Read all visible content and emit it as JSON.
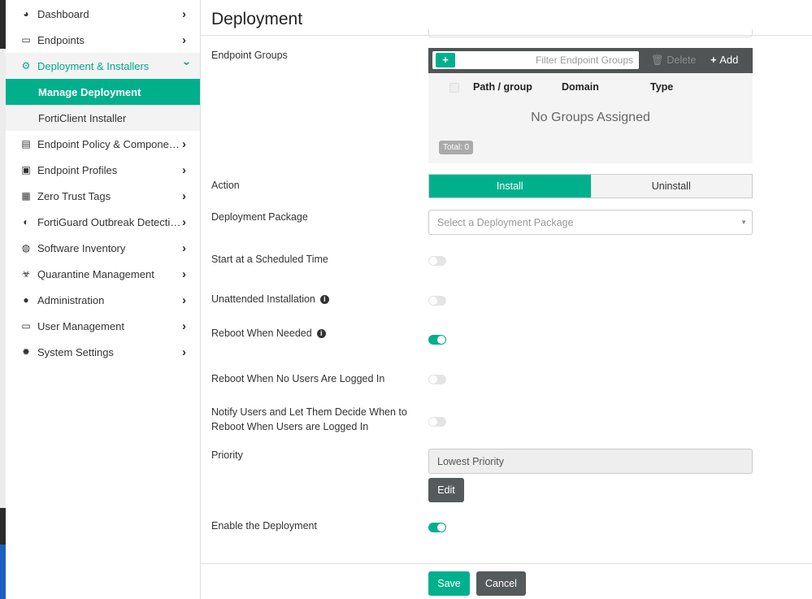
{
  "sidebar": {
    "items": [
      {
        "label": "Dashboard",
        "icon": "dashboard-icon"
      },
      {
        "label": "Endpoints",
        "icon": "endpoints-icon"
      },
      {
        "label": "Deployment & Installers",
        "icon": "deployment-icon",
        "expanded": true,
        "children": [
          {
            "label": "Manage Deployment",
            "active": true
          },
          {
            "label": "FortiClient Installer"
          }
        ]
      },
      {
        "label": "Endpoint Policy & Components",
        "icon": "policy-icon"
      },
      {
        "label": "Endpoint Profiles",
        "icon": "profiles-icon"
      },
      {
        "label": "Zero Trust Tags",
        "icon": "tags-icon"
      },
      {
        "label": "FortiGuard Outbreak Detecti…",
        "icon": "outbreak-icon"
      },
      {
        "label": "Software Inventory",
        "icon": "inventory-icon"
      },
      {
        "label": "Quarantine Management",
        "icon": "biohazard-icon"
      },
      {
        "label": "Administration",
        "icon": "users-icon"
      },
      {
        "label": "User Management",
        "icon": "id-card-icon"
      },
      {
        "label": "System Settings",
        "icon": "gear-icon"
      }
    ]
  },
  "page": {
    "title": "Deployment"
  },
  "form": {
    "endpoint_groups": {
      "label": "Endpoint Groups",
      "filter_placeholder": "Filter Endpoint Groups",
      "delete": "Delete",
      "add": "Add",
      "columns": [
        "Path / group",
        "Domain",
        "Type"
      ],
      "empty": "No Groups Assigned",
      "total": "Total: 0"
    },
    "action": {
      "label": "Action",
      "options": [
        "Install",
        "Uninstall"
      ],
      "selected": "Install"
    },
    "package": {
      "label": "Deployment Package",
      "placeholder": "Select a Deployment Package"
    },
    "scheduled": {
      "label": "Start at a Scheduled Time",
      "on": false
    },
    "unattended": {
      "label": "Unattended Installation",
      "on": false
    },
    "reboot_needed": {
      "label": "Reboot When Needed",
      "on": true
    },
    "reboot_no_users": {
      "label": "Reboot When No Users Are Logged In",
      "on": false
    },
    "notify": {
      "label_line1": "Notify Users and Let Them Decide When to",
      "label_line2": "Reboot When Users are Logged In",
      "on": false
    },
    "priority": {
      "label": "Priority",
      "value": "Lowest Priority",
      "edit": "Edit"
    },
    "enable": {
      "label": "Enable the Deployment",
      "on": true
    }
  },
  "footer": {
    "save": "Save",
    "cancel": "Cancel"
  },
  "colors": {
    "accent": "#00b08d",
    "toolbar": "#505455",
    "dark_button": "#555a5c"
  }
}
